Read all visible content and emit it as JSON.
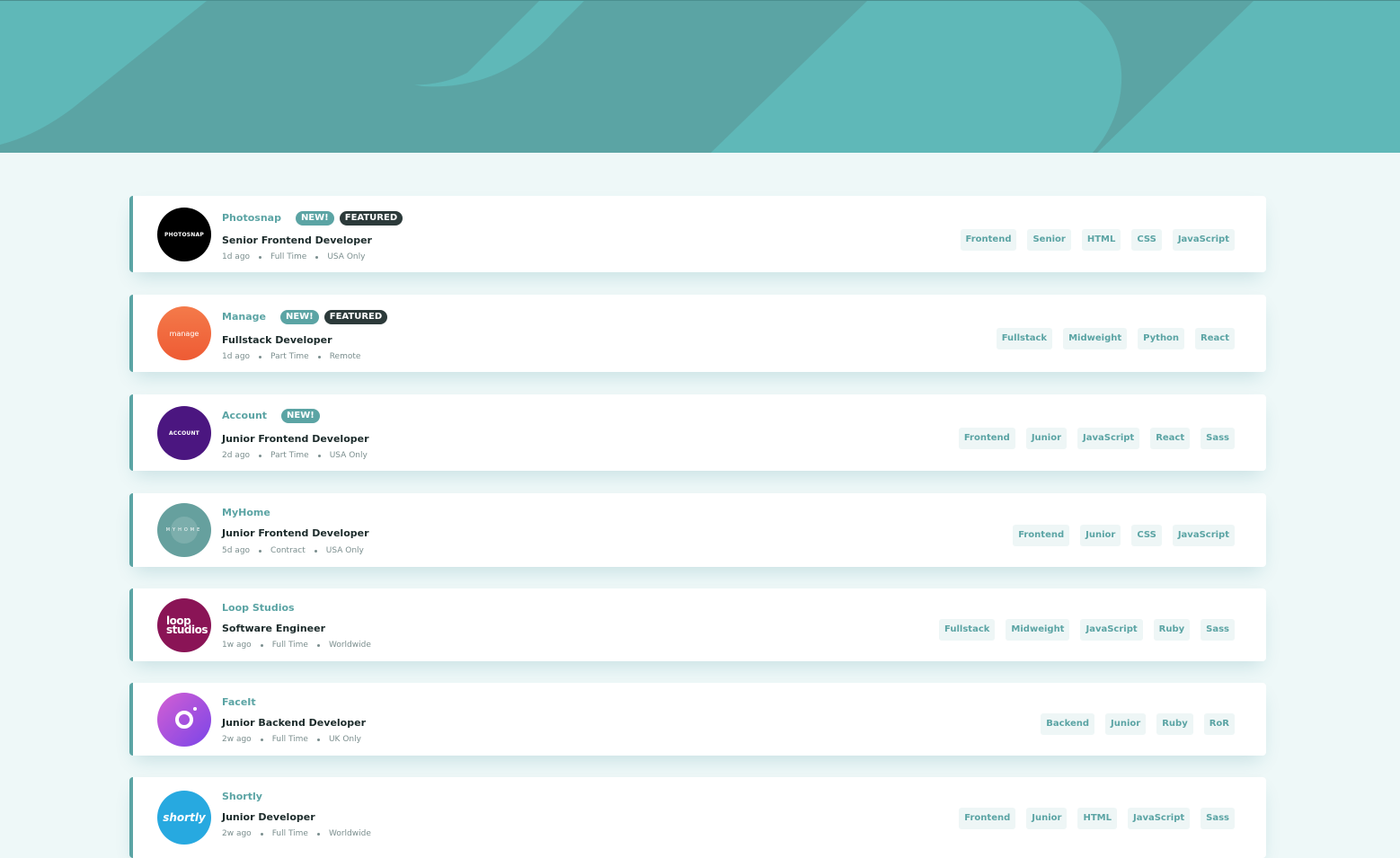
{
  "colors": {
    "primary": "#5ba4a4",
    "page_background": "#eef8f8",
    "header_background": "#5fb8b8",
    "featured_badge": "#2c3a3a",
    "tag_background": "#eef6f6"
  },
  "jobs": [
    {
      "company": "Photosnap",
      "logo_text": "PHOTOSNAP",
      "logo_color": "#000000",
      "new": true,
      "new_label": "NEW!",
      "featured": true,
      "featured_label": "FEATURED",
      "position": "Senior Frontend Developer",
      "posted": "1d ago",
      "contract": "Full Time",
      "location": "USA Only",
      "tags": [
        "Frontend",
        "Senior",
        "HTML",
        "CSS",
        "JavaScript"
      ]
    },
    {
      "company": "Manage",
      "logo_text": "manage",
      "logo_color": "#f26a3d",
      "new": true,
      "new_label": "NEW!",
      "featured": true,
      "featured_label": "FEATURED",
      "position": "Fullstack Developer",
      "posted": "1d ago",
      "contract": "Part Time",
      "location": "Remote",
      "tags": [
        "Fullstack",
        "Midweight",
        "Python",
        "React"
      ]
    },
    {
      "company": "Account",
      "logo_text": "ACCOUNT",
      "logo_color": "#4b1680",
      "new": true,
      "new_label": "NEW!",
      "featured": false,
      "position": "Junior Frontend Developer",
      "posted": "2d ago",
      "contract": "Part Time",
      "location": "USA Only",
      "tags": [
        "Frontend",
        "Junior",
        "JavaScript",
        "React",
        "Sass"
      ]
    },
    {
      "company": "MyHome",
      "logo_text": "MYHOME",
      "logo_color": "#66a09e",
      "new": false,
      "featured": false,
      "position": "Junior Frontend Developer",
      "posted": "5d ago",
      "contract": "Contract",
      "location": "USA Only",
      "tags": [
        "Frontend",
        "Junior",
        "CSS",
        "JavaScript"
      ]
    },
    {
      "company": "Loop Studios",
      "logo_text": "loop studios",
      "logo_color": "#8a1456",
      "new": false,
      "featured": false,
      "position": "Software Engineer",
      "posted": "1w ago",
      "contract": "Full Time",
      "location": "Worldwide",
      "tags": [
        "Fullstack",
        "Midweight",
        "JavaScript",
        "Ruby",
        "Sass"
      ]
    },
    {
      "company": "FaceIt",
      "logo_text": "",
      "logo_color": "#a25ae0",
      "new": false,
      "featured": false,
      "position": "Junior Backend Developer",
      "posted": "2w ago",
      "contract": "Full Time",
      "location": "UK Only",
      "tags": [
        "Backend",
        "Junior",
        "Ruby",
        "RoR"
      ]
    },
    {
      "company": "Shortly",
      "logo_text": "shortly",
      "logo_color": "#27a9e0",
      "new": false,
      "featured": false,
      "position": "Junior Developer",
      "posted": "2w ago",
      "contract": "Full Time",
      "location": "Worldwide",
      "tags": [
        "Frontend",
        "Junior",
        "HTML",
        "JavaScript",
        "Sass"
      ]
    }
  ]
}
